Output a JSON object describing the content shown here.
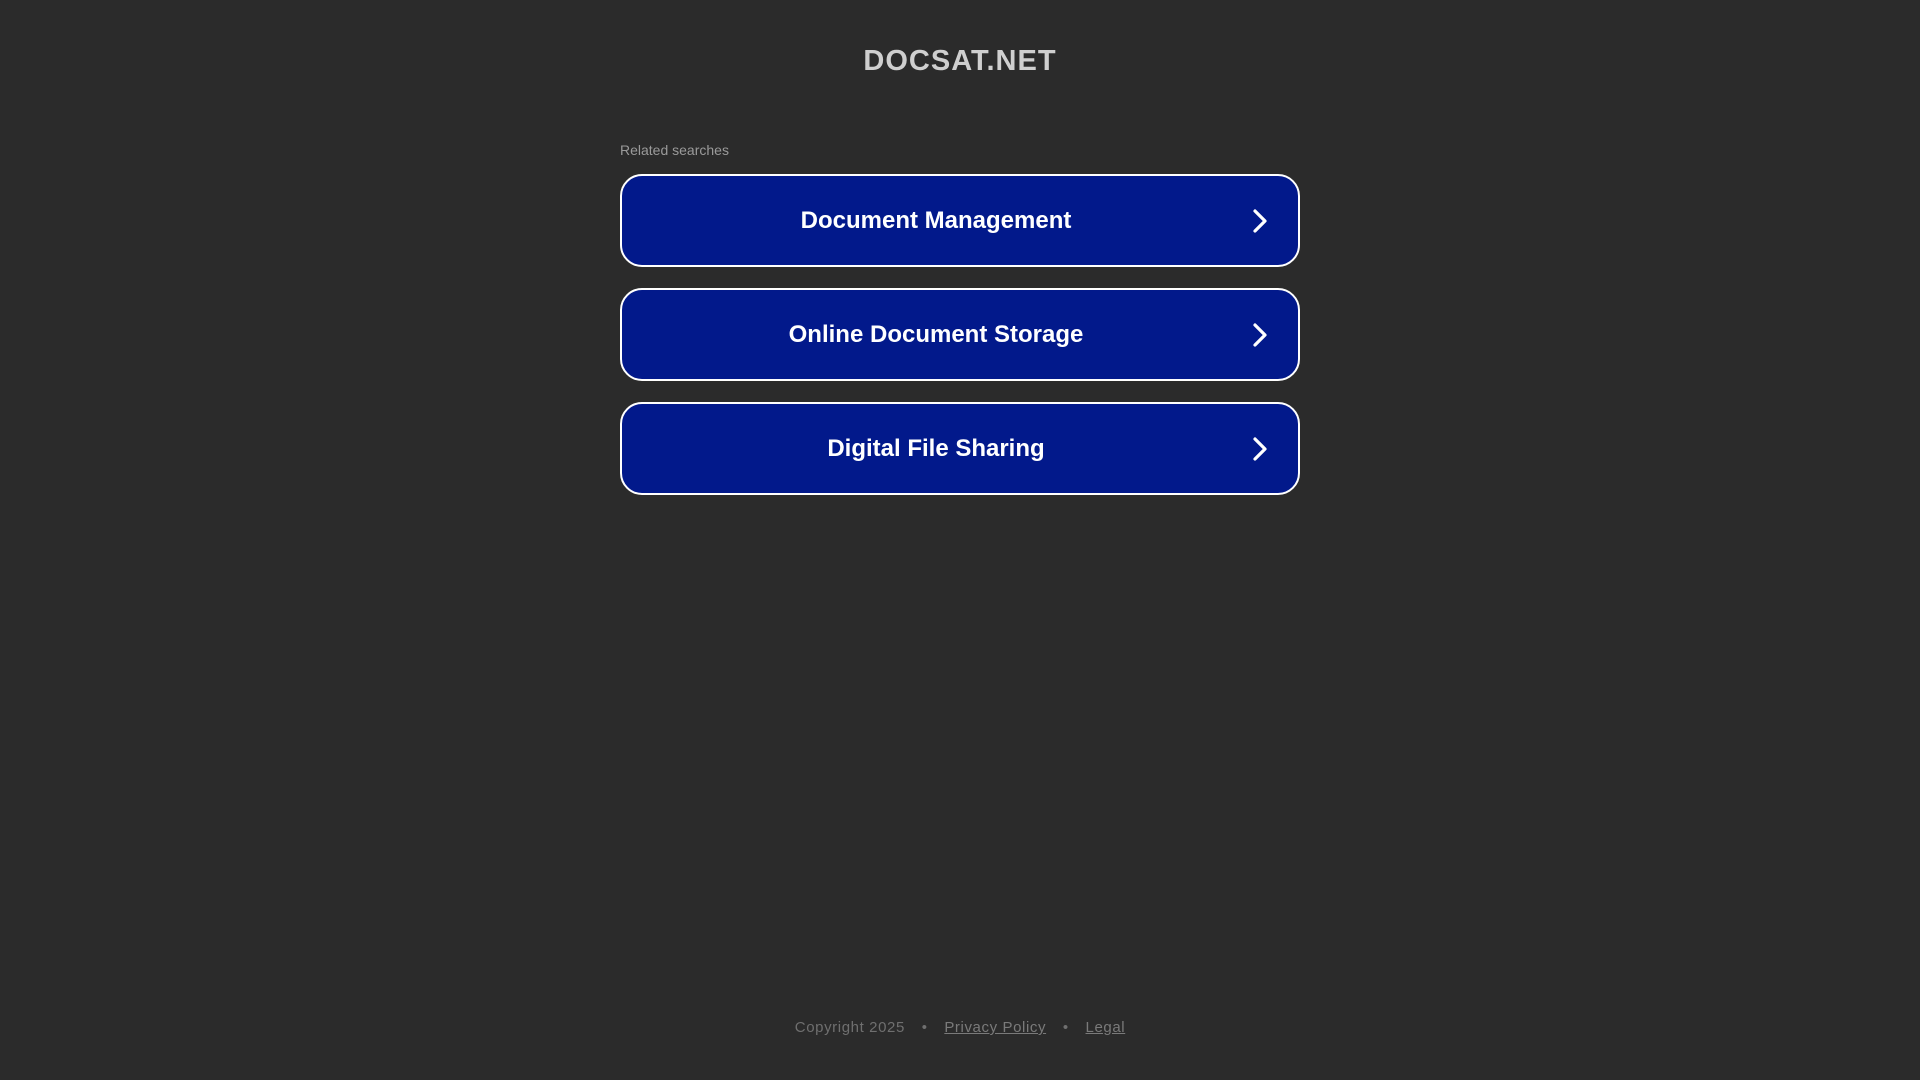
{
  "header": {
    "site_title": "DOCSAT.NET"
  },
  "related": {
    "label": "Related searches",
    "items": [
      {
        "label": "Document Management",
        "icon": "chevron-right-icon"
      },
      {
        "label": "Online Document Storage",
        "icon": "chevron-right-icon"
      },
      {
        "label": "Digital File Sharing",
        "icon": "chevron-right-icon"
      }
    ]
  },
  "footer": {
    "copyright": "Copyright 2025",
    "separator": "•",
    "privacy_label": "Privacy Policy",
    "legal_label": "Legal"
  },
  "colors": {
    "background": "#2b2b2b",
    "button_fill": "#02198b",
    "button_border": "#ffffff",
    "title_text": "#cfcfcf"
  }
}
